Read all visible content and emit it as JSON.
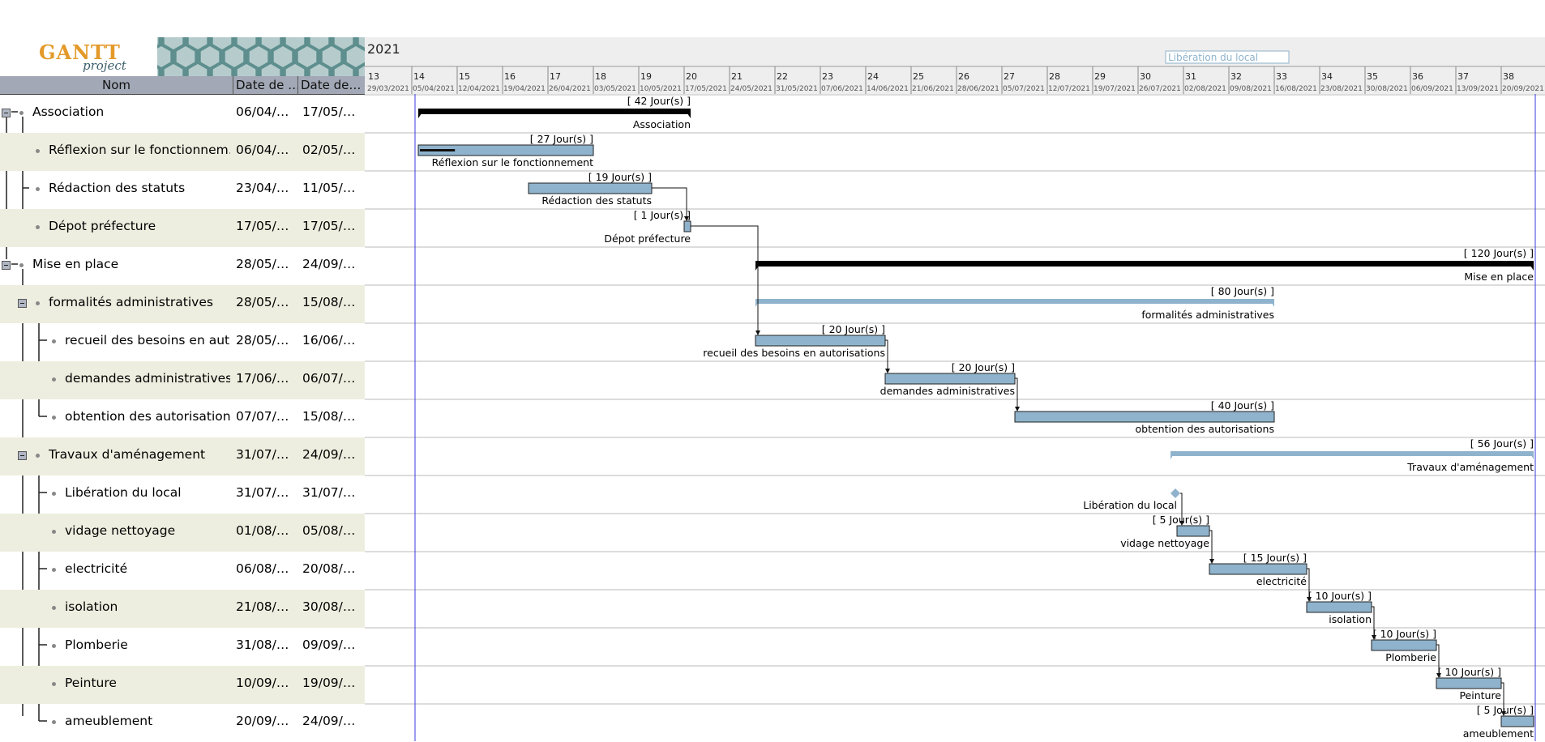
{
  "app": {
    "logo_text": "GANTT",
    "logo_sub": "project"
  },
  "table": {
    "columns": [
      "Nom",
      "Date de …",
      "Date de…"
    ],
    "rows": [
      {
        "name": "Association",
        "start": "06/04/…",
        "end": "17/05/…",
        "level": 0,
        "group": true
      },
      {
        "name": "Réflexion sur le fonctionnem…",
        "start": "06/04/…",
        "end": "02/05/…",
        "level": 1,
        "group": false
      },
      {
        "name": "Rédaction des statuts",
        "start": "23/04/…",
        "end": "11/05/…",
        "level": 1,
        "group": false
      },
      {
        "name": "Dépot préfecture",
        "start": "17/05/…",
        "end": "17/05/…",
        "level": 1,
        "group": false
      },
      {
        "name": "Mise en place",
        "start": "28/05/…",
        "end": "24/09/…",
        "level": 0,
        "group": true
      },
      {
        "name": "formalités administratives",
        "start": "28/05/…",
        "end": "15/08/…",
        "level": 1,
        "group": true
      },
      {
        "name": "recueil des besoins en aut…",
        "start": "28/05/…",
        "end": "16/06/…",
        "level": 2,
        "group": false
      },
      {
        "name": "demandes administratives",
        "start": "17/06/…",
        "end": "06/07/…",
        "level": 2,
        "group": false
      },
      {
        "name": "obtention des autorisations",
        "start": "07/07/…",
        "end": "15/08/…",
        "level": 2,
        "group": false
      },
      {
        "name": "Travaux d'aménagement",
        "start": "31/07/…",
        "end": "24/09/…",
        "level": 1,
        "group": true
      },
      {
        "name": "Libération du local",
        "start": "31/07/…",
        "end": "31/07/…",
        "level": 2,
        "group": false
      },
      {
        "name": "vidage nettoyage",
        "start": "01/08/…",
        "end": "05/08/…",
        "level": 2,
        "group": false
      },
      {
        "name": "electricité",
        "start": "06/08/…",
        "end": "20/08/…",
        "level": 2,
        "group": false
      },
      {
        "name": "isolation",
        "start": "21/08/…",
        "end": "30/08/…",
        "level": 2,
        "group": false
      },
      {
        "name": "Plomberie",
        "start": "31/08/…",
        "end": "09/09/…",
        "level": 2,
        "group": false
      },
      {
        "name": "Peinture",
        "start": "10/09/…",
        "end": "19/09/…",
        "level": 2,
        "group": false
      },
      {
        "name": "ameublement",
        "start": "20/09/…",
        "end": "24/09/…",
        "level": 2,
        "group": false
      }
    ]
  },
  "timeline": {
    "year": "2021",
    "milestone_flag": "Libération du local",
    "weeks": [
      "13",
      "14",
      "15",
      "16",
      "17",
      "18",
      "19",
      "20",
      "21",
      "22",
      "23",
      "24",
      "25",
      "26",
      "27",
      "28",
      "29",
      "30",
      "31",
      "32",
      "33",
      "34",
      "35",
      "36",
      "37",
      "38"
    ],
    "dates": [
      "29/03/2021",
      "05/04/2021",
      "12/04/2021",
      "19/04/2021",
      "26/04/2021",
      "03/05/2021",
      "10/05/2021",
      "17/05/2021",
      "24/05/2021",
      "31/05/2021",
      "07/06/2021",
      "14/06/2021",
      "21/06/2021",
      "28/06/2021",
      "05/07/2021",
      "12/07/2021",
      "19/07/2021",
      "26/07/2021",
      "02/08/2021",
      "09/08/2021",
      "16/08/2021",
      "23/08/2021",
      "30/08/2021",
      "06/09/2021",
      "13/09/2021",
      "20/09/2021"
    ]
  },
  "bars": [
    {
      "row": 0,
      "kind": "summary",
      "start": "2021-04-06",
      "end": "2021-05-17",
      "duration": "[ 42 Jour(s) ]",
      "label": "Association"
    },
    {
      "row": 1,
      "kind": "task",
      "start": "2021-04-06",
      "end": "2021-05-02",
      "duration": "[ 27 Jour(s) ]",
      "label": "Réflexion sur le fonctionnement",
      "progress": 0.2
    },
    {
      "row": 2,
      "kind": "task",
      "start": "2021-04-23",
      "end": "2021-05-11",
      "duration": "[ 19 Jour(s) ]",
      "label": "Rédaction des statuts"
    },
    {
      "row": 3,
      "kind": "task",
      "start": "2021-05-17",
      "end": "2021-05-17",
      "duration": "[ 1 Jour(s) ]",
      "label": "Dépot préfecture"
    },
    {
      "row": 4,
      "kind": "summary",
      "start": "2021-05-28",
      "end": "2021-09-24",
      "duration": "[ 120 Jour(s) ]",
      "label": "Mise en place"
    },
    {
      "row": 5,
      "kind": "subsummary",
      "start": "2021-05-28",
      "end": "2021-08-15",
      "duration": "[ 80 Jour(s) ]",
      "label": "formalités administratives"
    },
    {
      "row": 6,
      "kind": "task",
      "start": "2021-05-28",
      "end": "2021-06-16",
      "duration": "[ 20 Jour(s) ]",
      "label": "recueil des besoins en autorisations"
    },
    {
      "row": 7,
      "kind": "task",
      "start": "2021-06-17",
      "end": "2021-07-06",
      "duration": "[ 20 Jour(s) ]",
      "label": "demandes administratives"
    },
    {
      "row": 8,
      "kind": "task",
      "start": "2021-07-07",
      "end": "2021-08-15",
      "duration": "[ 40 Jour(s) ]",
      "label": "obtention des autorisations"
    },
    {
      "row": 9,
      "kind": "subsummary",
      "start": "2021-07-31",
      "end": "2021-09-24",
      "duration": "[ 56 Jour(s) ]",
      "label": "Travaux d'aménagement"
    },
    {
      "row": 10,
      "kind": "milestone",
      "start": "2021-07-31",
      "end": "2021-07-31",
      "duration": "",
      "label": "Libération du local"
    },
    {
      "row": 11,
      "kind": "task",
      "start": "2021-08-01",
      "end": "2021-08-05",
      "duration": "[ 5 Jour(s) ]",
      "label": "vidage nettoyage"
    },
    {
      "row": 12,
      "kind": "task",
      "start": "2021-08-06",
      "end": "2021-08-20",
      "duration": "[ 15 Jour(s) ]",
      "label": "electricité"
    },
    {
      "row": 13,
      "kind": "task",
      "start": "2021-08-21",
      "end": "2021-08-30",
      "duration": "[ 10 Jour(s) ]",
      "label": "isolation"
    },
    {
      "row": 14,
      "kind": "task",
      "start": "2021-08-31",
      "end": "2021-09-09",
      "duration": "[ 10 Jour(s) ]",
      "label": "Plomberie"
    },
    {
      "row": 15,
      "kind": "task",
      "start": "2021-09-10",
      "end": "2021-09-19",
      "duration": "[ 10 Jour(s) ]",
      "label": "Peinture"
    },
    {
      "row": 16,
      "kind": "task",
      "start": "2021-09-20",
      "end": "2021-09-24",
      "duration": "[ 5 Jour(s) ]",
      "label": "ameublement"
    }
  ],
  "dependencies": [
    [
      2,
      3
    ],
    [
      3,
      6
    ],
    [
      6,
      7
    ],
    [
      7,
      8
    ],
    [
      10,
      11
    ],
    [
      11,
      12
    ],
    [
      12,
      13
    ],
    [
      13,
      14
    ],
    [
      14,
      15
    ],
    [
      15,
      16
    ]
  ],
  "colors": {
    "task_fill": "#8fb3cc",
    "summary": "#000000",
    "subsummary": "#8fb3cc",
    "row_alt": "#eeeee0",
    "today_line": "#3b3bdf",
    "header_bg": "#eeeeee"
  }
}
